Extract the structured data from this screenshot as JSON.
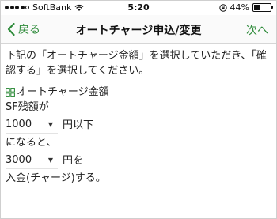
{
  "status_bar": {
    "carrier": "SoftBank",
    "time": "5:20",
    "battery": "44%",
    "battery_level": 0.44
  },
  "nav": {
    "back_label": "戻る",
    "title": "オートチャージ申込/変更",
    "next_label": "次へ"
  },
  "intro_text": "下記の「オートチャージ金額」を選択していただき、「確認する」を選択してください。",
  "section": {
    "heading": "オートチャージ金額",
    "line_sf": "SF残額が",
    "threshold": {
      "value": "1000",
      "suffix": "円以下"
    },
    "line_then": "になると、",
    "charge": {
      "value": "3000",
      "suffix": "円を"
    },
    "line_end": "入金(チャージ)する。"
  },
  "colors": {
    "accent": "#2e8b3a"
  }
}
